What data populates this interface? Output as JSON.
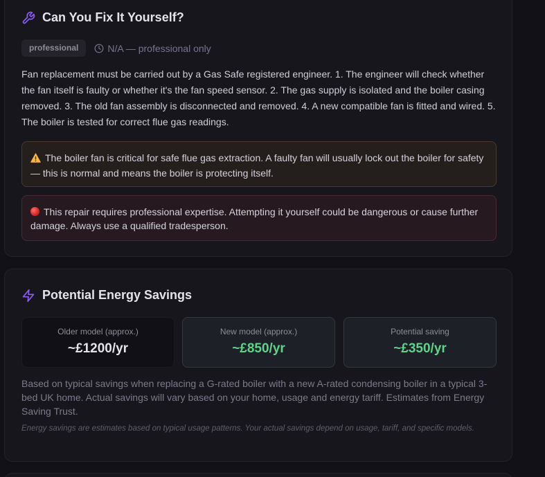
{
  "fix_card": {
    "title": "Can You Fix It Yourself?",
    "title_icon": "wrench-icon",
    "badge": "professional",
    "time_icon": "clock-icon",
    "time_text": "N/A — professional only",
    "description": "Fan replacement must be carried out by a Gas Safe registered engineer. 1. The engineer will check whether the fan itself is faulty or whether it's the fan speed sensor. 2. The gas supply is isolated and the boiler casing removed. 3. The old fan assembly is disconnected and removed. 4. A new compatible fan is fitted and wired. 5. The boiler is tested for correct flue gas readings.",
    "warning": {
      "icon": "warning-triangle-icon",
      "text": "The boiler fan is critical for safe flue gas extraction. A faulty fan will usually lock out the boiler for safety — this is normal and means the boiler is protecting itself."
    },
    "danger": {
      "icon": "red-circle-icon",
      "text": "This repair requires professional expertise. Attempting it yourself could be dangerous or cause further damage. Always use a qualified tradesperson."
    }
  },
  "energy_card": {
    "title": "Potential Energy Savings",
    "title_icon": "lightning-bolt-icon",
    "stats": [
      {
        "label": "Older model (approx.)",
        "value": "~£1200/yr"
      },
      {
        "label": "New model (approx.)",
        "value": "~£850/yr"
      },
      {
        "label": "Potential saving",
        "value": "~£350/yr"
      }
    ],
    "description": "Based on typical savings when replacing a G-rated boiler with a new A-rated condensing boiler in a typical 3-bed UK home. Actual savings will vary based on your home, usage and energy tariff. Estimates from Energy Saving Trust.",
    "disclaimer": "Energy savings are estimates based on typical usage patterns. Your actual savings depend on usage, tariff, and specific models."
  },
  "colors": {
    "accent": "#8b5cf6",
    "saving_green": "#5fd38a",
    "warning_border": "#4a3b2a",
    "danger_border": "#4d2833"
  }
}
